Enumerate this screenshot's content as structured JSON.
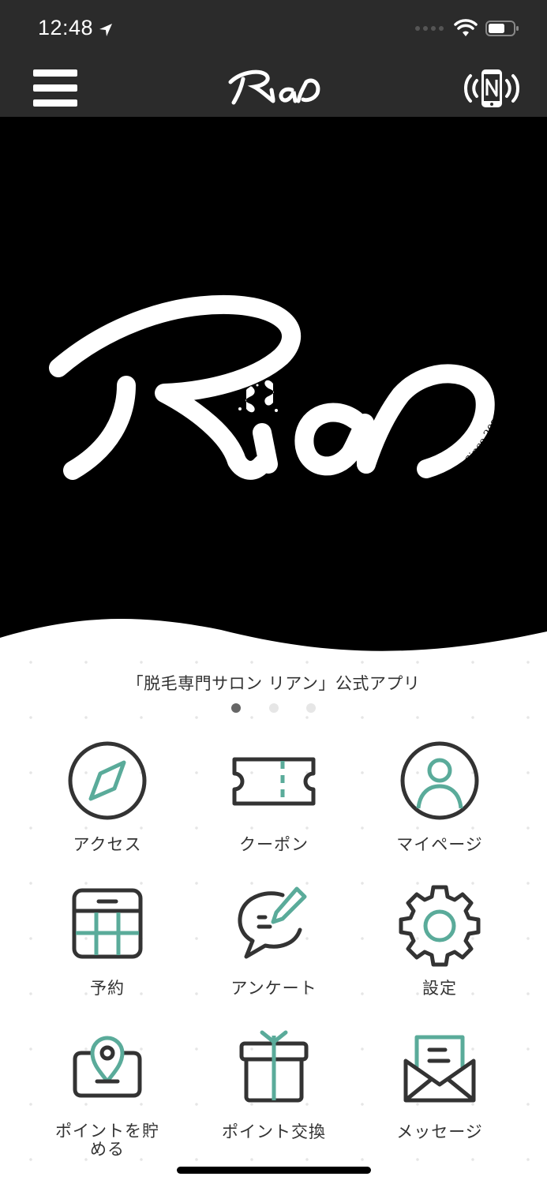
{
  "status_bar": {
    "time": "12:48"
  },
  "brand": {
    "logo_text": "Rian",
    "since_text": "Since 2023"
  },
  "subtitle": "「脱毛専門サロン リアン」公式アプリ",
  "pager": {
    "count": 3,
    "active": 1
  },
  "tiles": [
    {
      "label": "アクセス",
      "icon": "compass-icon"
    },
    {
      "label": "クーポン",
      "icon": "ticket-icon"
    },
    {
      "label": "マイページ",
      "icon": "person-icon"
    },
    {
      "label": "予約",
      "icon": "calendar-icon"
    },
    {
      "label": "アンケート",
      "icon": "chat-edit-icon"
    },
    {
      "label": "設定",
      "icon": "gear-icon"
    },
    {
      "label": "ポイントを貯める",
      "label_line1": "ポイントを貯",
      "label_line2": "める",
      "icon": "location-pin-icon"
    },
    {
      "label": "ポイント交換",
      "icon": "gift-icon"
    },
    {
      "label": "メッセージ",
      "icon": "envelope-icon"
    }
  ],
  "colors": {
    "accent": "#5aab9a",
    "dark": "#333333",
    "bar": "#2b2b2b"
  }
}
